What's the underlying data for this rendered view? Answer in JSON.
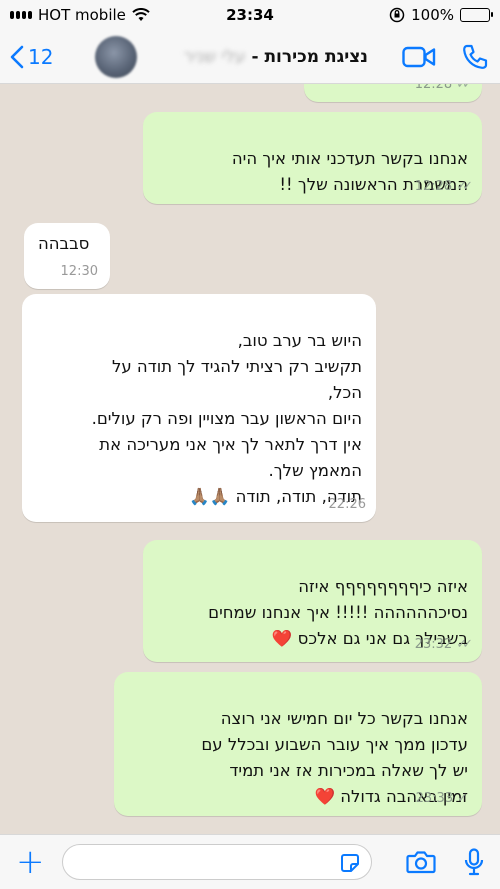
{
  "status_bar": {
    "carrier": "HOT mobile",
    "time": "23:34",
    "battery": "100%",
    "battery_level": 1.0
  },
  "header": {
    "back_count": "12",
    "contact_name": "נציגת מכירות -",
    "contact_name_blurred": "עלי שניר"
  },
  "messages": [
    {
      "direction": "outgoing",
      "text": "",
      "time": "12:28",
      "status": "read"
    },
    {
      "direction": "outgoing",
      "text": "אנחנו בקשר תעדכני אותי איך היה\nהמשמרת הראשונה שלך !!",
      "time": "12:28",
      "status": "read"
    },
    {
      "direction": "incoming",
      "text": "סבבהה",
      "time": "12:30"
    },
    {
      "direction": "incoming",
      "text": "היוש בר ערב טוב,\nתקשיב רק רציתי להגיד לך תודה על\nהכל,\nהיום הראשון עבר מצויין ופה רק עולים.\nאין דרך לתאר לך איך אני מעריכה את\nהמאמץ שלך.\nתודה, תודה, תודה 🙏🏽🙏🏽",
      "time": "22:26"
    },
    {
      "direction": "outgoing",
      "text": "איזה כיףףףףףףףף איזה\nנסיכהההההה !!!!! איך אנחנו שמחים\nבשבילך גם אני גם אלכס ❤️",
      "time": "23:32",
      "status": "read"
    },
    {
      "direction": "outgoing",
      "text": "אנחנו בקשר כל יום חמישי  אני רוצה\nעדכון ממך איך עובר השבוע ובכלל עם\nיש לך שאלה במכירות אז אני תמיד\nזמין באהבה גדולה ❤️",
      "time": "23:33",
      "status": "delivered"
    }
  ],
  "input": {
    "placeholder": ""
  }
}
